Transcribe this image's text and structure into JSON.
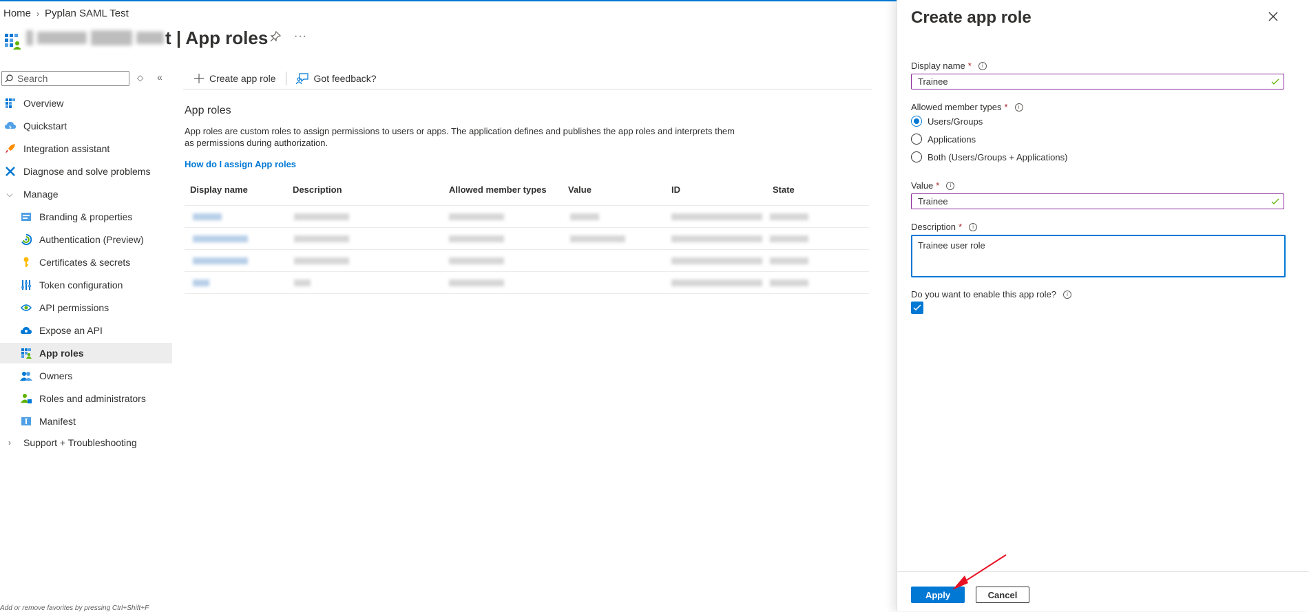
{
  "breadcrumb": {
    "home": "Home",
    "app": "Pyplan SAML Test"
  },
  "header": {
    "title_suffix": "t | App roles"
  },
  "nav": {
    "search_placeholder": "Search",
    "items": [
      {
        "label": "Overview"
      },
      {
        "label": "Quickstart"
      },
      {
        "label": "Integration assistant"
      },
      {
        "label": "Diagnose and solve problems"
      },
      {
        "label": "Manage"
      },
      {
        "label": "Branding & properties"
      },
      {
        "label": "Authentication (Preview)"
      },
      {
        "label": "Certificates & secrets"
      },
      {
        "label": "Token configuration"
      },
      {
        "label": "API permissions"
      },
      {
        "label": "Expose an API"
      },
      {
        "label": "App roles"
      },
      {
        "label": "Owners"
      },
      {
        "label": "Roles and administrators"
      },
      {
        "label": "Manifest"
      },
      {
        "label": "Support + Troubleshooting"
      }
    ],
    "favorites_hint": "Add or remove favorites by pressing Ctrl+Shift+F"
  },
  "toolbar": {
    "create_label": "Create app role",
    "feedback_label": "Got feedback?"
  },
  "main": {
    "section_title": "App roles",
    "description": "App roles are custom roles to assign permissions to users or apps. The application defines and publishes the app roles and interprets them as permissions during authorization.",
    "help_link": "How do I assign App roles",
    "columns": [
      "Display name",
      "Description",
      "Allowed member types",
      "Value",
      "ID",
      "State"
    ]
  },
  "panel": {
    "title": "Create app role",
    "display_name_label": "Display name",
    "display_name_value": "Trainee",
    "member_types_label": "Allowed member types",
    "member_types": [
      "Users/Groups",
      "Applications",
      "Both (Users/Groups + Applications)"
    ],
    "value_label": "Value",
    "value_value": "Trainee",
    "description_label": "Description",
    "description_value": "Trainee user role",
    "enable_label": "Do you want to enable this app role?",
    "apply_label": "Apply",
    "cancel_label": "Cancel"
  },
  "colors": {
    "accent": "#0078d4",
    "valid_border": "#8b2a9b",
    "annotation": "#e81123"
  }
}
